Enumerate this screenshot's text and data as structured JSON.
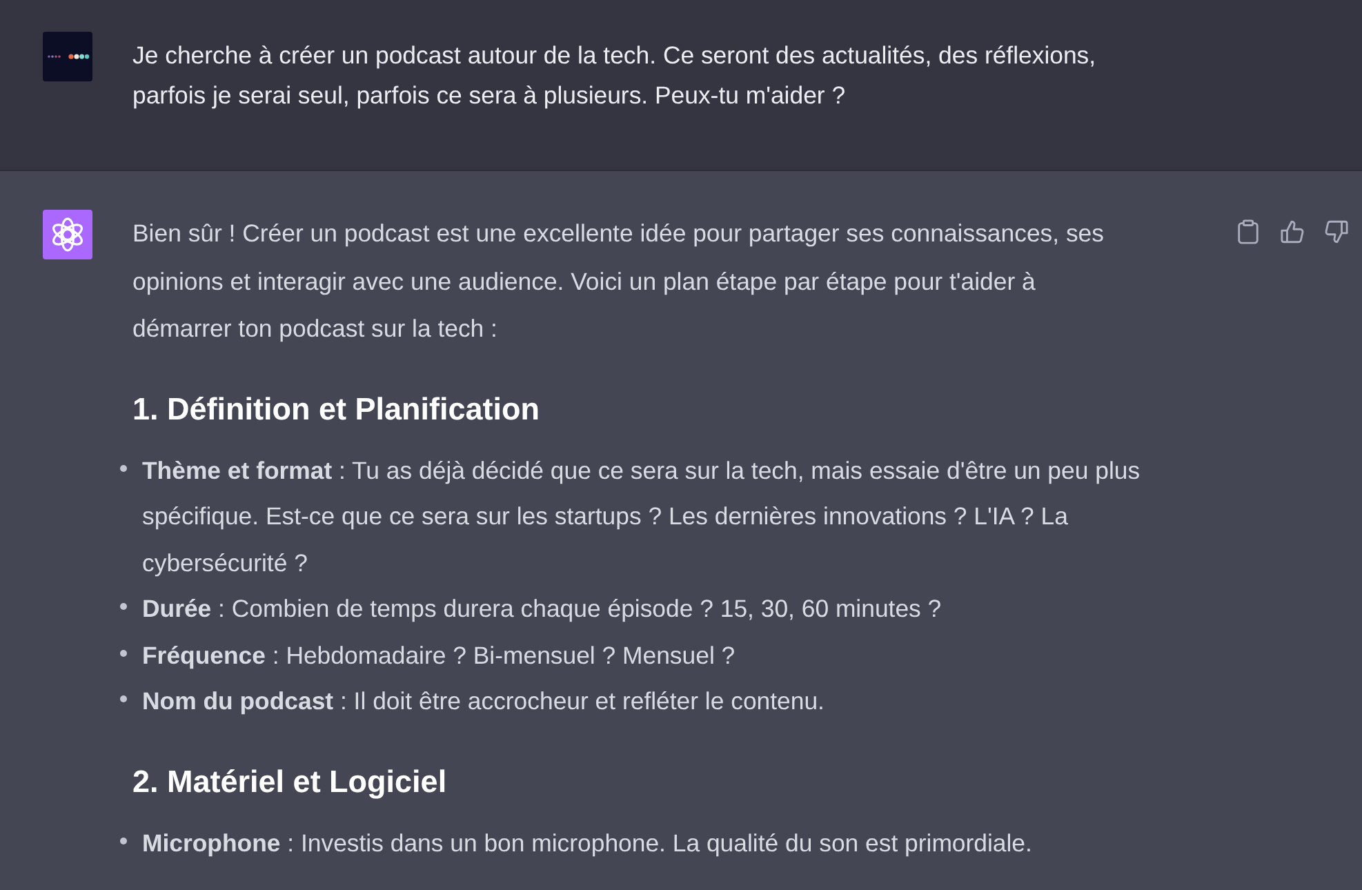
{
  "conversation": [
    {
      "kind": "user",
      "text": "Je cherche à créer un podcast autour de la tech. Ce seront des actualités, des réflexions, parfois je serai seul, parfois ce sera à plusieurs. Peux-tu m'aider ?"
    },
    {
      "kind": "assistant",
      "blocks": [
        {
          "kind": "paragraph",
          "text": "Bien sûr ! Créer un podcast est une excellente idée pour partager ses connaissances, ses opinions et interagir avec une audience. Voici un plan étape par étape pour t'aider à démarrer ton podcast sur la tech :"
        },
        {
          "kind": "heading",
          "text": "1. Définition et Planification"
        },
        {
          "kind": "list",
          "items": [
            "**Thème et format** : Tu as déjà décidé que ce sera sur la tech, mais essaie d'être un peu plus spécifique. Est-ce que ce sera sur les startups ? Les dernières innovations ? L'IA ? La cybersécurité ?",
            "**Durée** : Combien de temps durera chaque épisode ? 15, 30, 60 minutes ?",
            "**Fréquence** : Hebdomadaire ? Bi-mensuel ? Mensuel ?",
            "**Nom du podcast** : Il doit être accrocheur et refléter le contenu."
          ]
        },
        {
          "kind": "heading",
          "text": "2. Matériel et Logiciel"
        },
        {
          "kind": "list",
          "items": [
            "**Microphone** : Investis dans un bon microphone. La qualité du son est primordiale."
          ]
        }
      ]
    }
  ]
}
